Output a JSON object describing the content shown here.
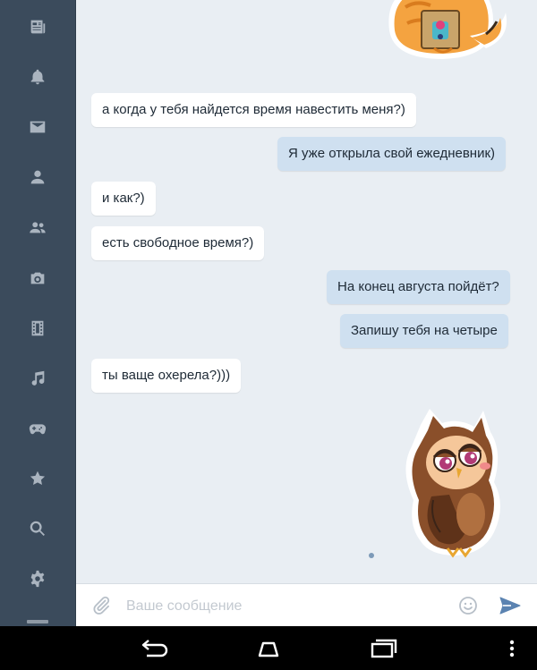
{
  "sidebar": {
    "items": [
      {
        "name": "news-icon"
      },
      {
        "name": "bell-icon"
      },
      {
        "name": "mail-icon"
      },
      {
        "name": "user-icon"
      },
      {
        "name": "friends-icon"
      },
      {
        "name": "camera-icon"
      },
      {
        "name": "film-icon"
      },
      {
        "name": "music-icon"
      },
      {
        "name": "gamepad-icon"
      },
      {
        "name": "star-icon"
      },
      {
        "name": "search-icon"
      },
      {
        "name": "gear-icon"
      }
    ]
  },
  "messages": [
    {
      "direction": "in",
      "text": "а когда у тебя найдется время навестить меня?)"
    },
    {
      "direction": "out",
      "text": "Я уже открыла свой ежедневник)"
    },
    {
      "direction": "in",
      "text": "и как?)"
    },
    {
      "direction": "in",
      "text": "есть свободное время?)"
    },
    {
      "direction": "out",
      "text": "На конец августа пойдёт?"
    },
    {
      "direction": "out",
      "text": "Запишу тебя  на четыре"
    },
    {
      "direction": "in",
      "text": "ты ваще охерела?)))"
    }
  ],
  "stickers": [
    {
      "name": "cat-sticker",
      "direction": "out"
    },
    {
      "name": "owl-sticker",
      "direction": "out"
    }
  ],
  "composer": {
    "placeholder": "Ваше сообщение"
  },
  "colors": {
    "sidebar_bg": "#3b4b5c",
    "chat_bg": "#e9eef3",
    "outgoing_bubble": "#cfe0f0",
    "incoming_bubble": "#ffffff",
    "send_accent": "#5b83b1"
  }
}
